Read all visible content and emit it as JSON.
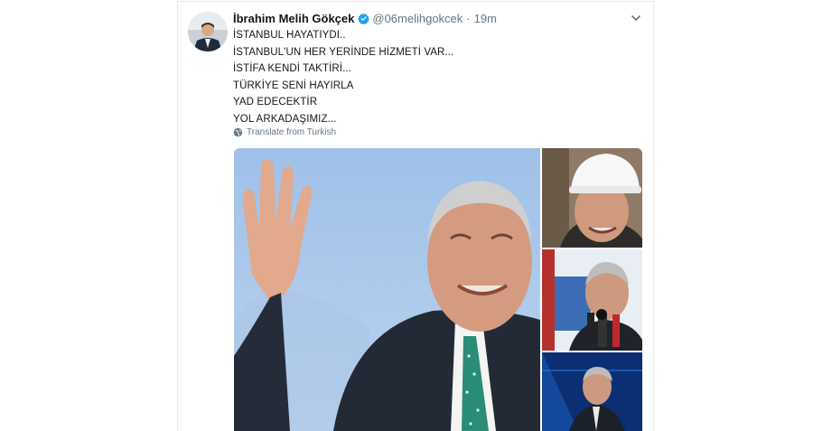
{
  "tweet": {
    "author_name": "İbrahim Melih Gökçek",
    "handle": "@06melihgokcek",
    "separator": "·",
    "time": "19m",
    "lines": [
      "İSTANBUL HAYATIYDI..",
      "İSTANBUL'UN HER YERİNDE HİZMETİ VAR...",
      "İSTİFA KENDİ TAKTİRİ...",
      "TÜRKİYE SENİ HAYIRLA",
      "YAD EDECEKTİR",
      "YOL ARKADAŞIMIZ..."
    ],
    "translate_label": "Translate from Turkish"
  },
  "icons": {
    "verified": "verified-badge-icon",
    "more": "chevron-down-icon",
    "translate": "globe-icon"
  },
  "colors": {
    "text": "#14171a",
    "secondary": "#657786",
    "verified": "#1da1f2",
    "border": "#e6ecf0"
  }
}
